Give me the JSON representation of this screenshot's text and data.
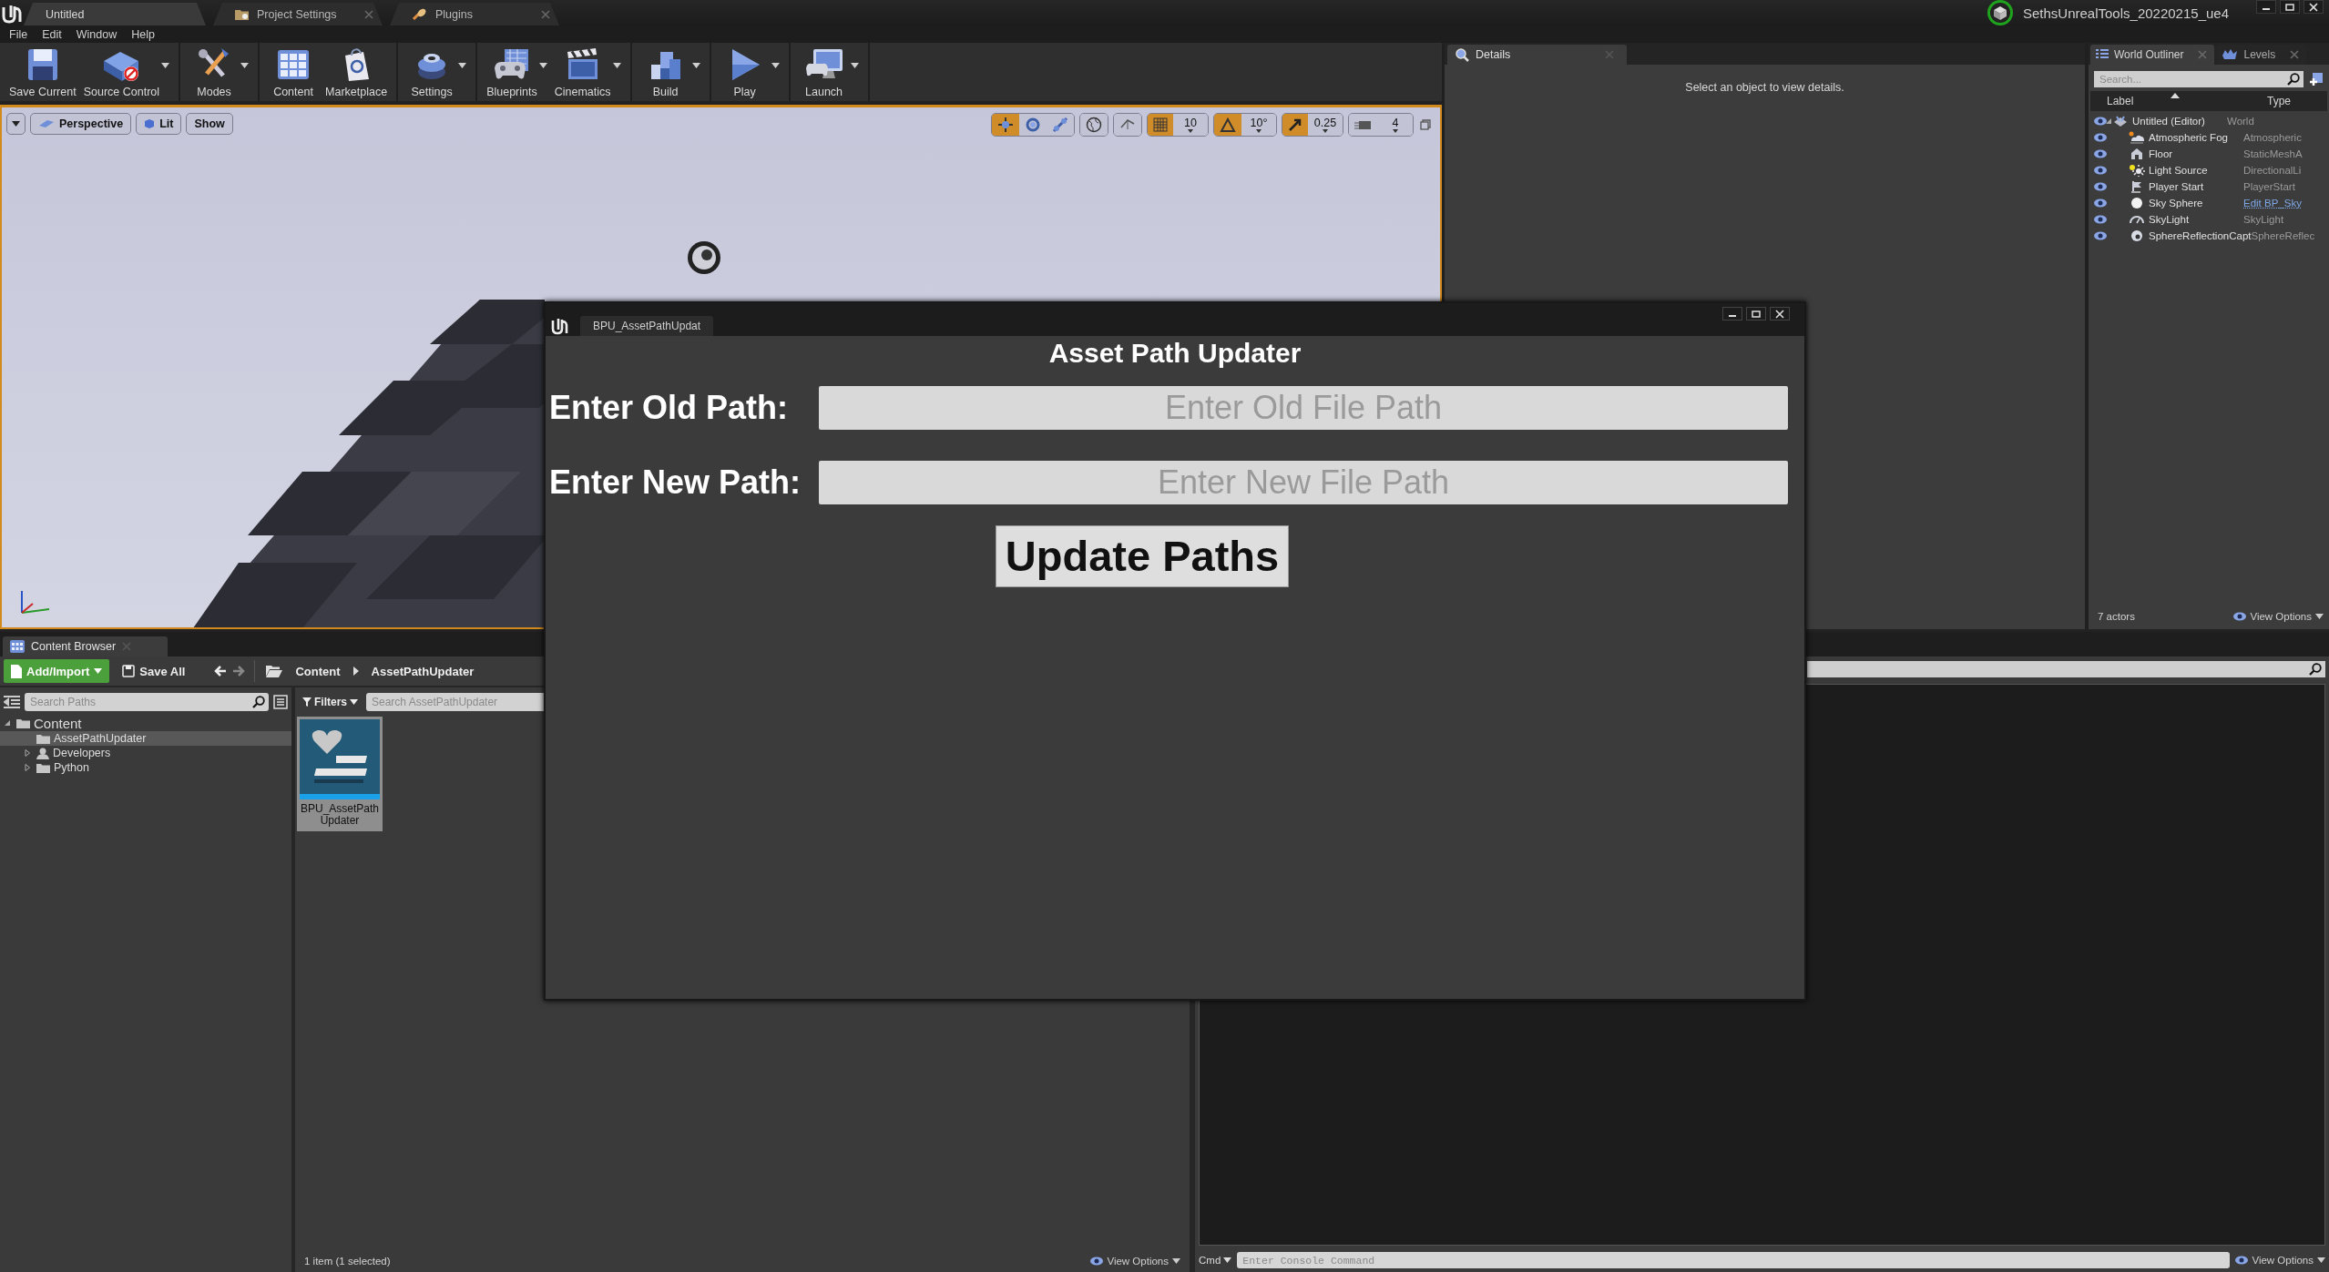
{
  "app_tabs": [
    {
      "label": "Untitled",
      "selected": true,
      "closable": false
    },
    {
      "label": "Project Settings",
      "selected": false,
      "closable": true
    },
    {
      "label": "Plugins",
      "selected": false,
      "closable": true
    }
  ],
  "project_name": "SethsUnrealTools_20220215_ue4",
  "menu": [
    "File",
    "Edit",
    "Window",
    "Help"
  ],
  "toolbar": [
    [
      {
        "label": "Save Current",
        "kind": "save",
        "dropdown": false
      },
      {
        "label": "Source Control",
        "kind": "source",
        "dropdown": true
      }
    ],
    [
      {
        "label": "Modes",
        "kind": "modes",
        "dropdown": true
      }
    ],
    [
      {
        "label": "Content",
        "kind": "content",
        "dropdown": false
      },
      {
        "label": "Marketplace",
        "kind": "marketplace",
        "dropdown": false
      }
    ],
    [
      {
        "label": "Settings",
        "kind": "settings",
        "dropdown": true
      }
    ],
    [
      {
        "label": "Blueprints",
        "kind": "blueprints",
        "dropdown": true
      },
      {
        "label": "Cinematics",
        "kind": "cinematics",
        "dropdown": true
      }
    ],
    [
      {
        "label": "Build",
        "kind": "build",
        "dropdown": true
      }
    ],
    [
      {
        "label": "Play",
        "kind": "play",
        "dropdown": true
      }
    ],
    [
      {
        "label": "Launch",
        "kind": "launch",
        "dropdown": true
      }
    ]
  ],
  "viewport": {
    "view_buttons": [
      {
        "label": "Perspective",
        "kind": "perspective"
      },
      {
        "label": "Lit",
        "kind": "lit"
      },
      {
        "label": "Show",
        "kind": "plain"
      }
    ],
    "transform_tools": [
      {
        "kind": "move",
        "selected": true
      },
      {
        "kind": "rotate",
        "selected": false
      },
      {
        "kind": "scale",
        "selected": false
      }
    ],
    "snaps": [
      {
        "kind": "grid",
        "value": "10",
        "on": true
      },
      {
        "kind": "angle",
        "value": "10°",
        "on": true
      },
      {
        "kind": "scale",
        "value": "0.25",
        "on": true
      },
      {
        "kind": "camera",
        "value": "4",
        "on": false
      }
    ]
  },
  "details": {
    "tab": "Details",
    "message": "Select an object to view details."
  },
  "outliner": {
    "tabs": [
      {
        "label": "World Outliner",
        "kind": "outliner",
        "selected": true
      },
      {
        "label": "Levels",
        "kind": "levels",
        "selected": false
      }
    ],
    "search": {
      "placeholder": "Search..."
    },
    "columns": [
      "Label",
      "Type"
    ],
    "rows": [
      {
        "label": "Untitled (Editor)",
        "type": "World",
        "kind": "world",
        "type_is_link": false,
        "expanded": true,
        "children": [
          {
            "label": "Atmospheric Fog",
            "type": "Atmospheric",
            "kind": "fog",
            "type_is_link": false
          },
          {
            "label": "Floor",
            "type": "StaticMeshA",
            "kind": "mesh",
            "type_is_link": false
          },
          {
            "label": "Light Source",
            "type": "DirectionalLi",
            "kind": "light",
            "type_is_link": false
          },
          {
            "label": "Player Start",
            "type": "PlayerStart",
            "kind": "player",
            "type_is_link": false
          },
          {
            "label": "Sky Sphere",
            "type": "Edit BP_Sky",
            "kind": "sphere",
            "type_is_link": true
          },
          {
            "label": "SkyLight",
            "type": "SkyLight",
            "kind": "skylight",
            "type_is_link": false
          },
          {
            "label": "SphereReflectionCapt",
            "type": "SphereReflec",
            "kind": "capture",
            "type_is_link": false
          }
        ]
      }
    ],
    "actor_count": "7 actors",
    "view_options": "View Options"
  },
  "content_browser": {
    "tab": "Content Browser",
    "add_button": "Add/Import",
    "save_all": "Save All",
    "breadcrumb": [
      "Content",
      "AssetPathUpdater"
    ],
    "path_search": {
      "placeholder": "Search Paths"
    },
    "filters": "Filters",
    "asset_search": {
      "placeholder": "Search AssetPathUpdater"
    },
    "tree": [
      {
        "label": "Content",
        "kind": "folder",
        "expanded": true,
        "selected": false,
        "children": [
          {
            "label": "AssetPathUpdater",
            "kind": "folder",
            "selected": true
          },
          {
            "label": "Developers",
            "kind": "person",
            "expanded": false,
            "selected": false
          },
          {
            "label": "Python",
            "kind": "folder",
            "expanded": false,
            "selected": false
          }
        ]
      }
    ],
    "assets": [
      {
        "name": "BPU_AssetPathUpdater",
        "selected": true
      }
    ],
    "status": "1 item (1 selected)",
    "view_options": "View Options"
  },
  "output_log": {
    "cmd": "Cmd",
    "console": {
      "placeholder": "Enter Console Command"
    },
    "view_options": "View Options"
  },
  "dialog": {
    "tab": "BPU_AssetPathUpdat",
    "heading": "Asset Path Updater",
    "fields": [
      {
        "label": "Enter Old Path:",
        "placeholder": "Enter Old File Path"
      },
      {
        "label": "Enter New Path:",
        "placeholder": "Enter New File Path"
      }
    ],
    "button": "Update Paths"
  }
}
